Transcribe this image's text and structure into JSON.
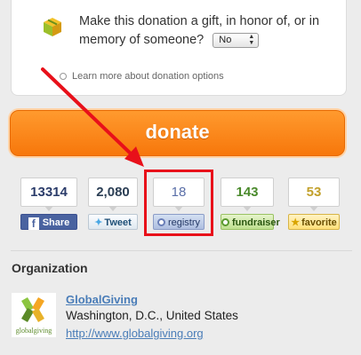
{
  "gift": {
    "text": "Make this donation a gift, in honor of, or in memory of someone?",
    "select_value": "No",
    "learn_more": "Learn more about donation options"
  },
  "donate": {
    "label": "donate"
  },
  "stats": [
    {
      "key": "facebook",
      "count": "13314",
      "label": "Share"
    },
    {
      "key": "twitter",
      "count": "2,080",
      "label": "Tweet"
    },
    {
      "key": "registry",
      "count": "18",
      "label": "registry"
    },
    {
      "key": "fundraiser",
      "count": "143",
      "label": "fundraiser"
    },
    {
      "key": "favorite",
      "count": "53",
      "label": "favorite"
    }
  ],
  "organization": {
    "heading": "Organization",
    "logo_text": "globalgiving",
    "name": "GlobalGiving",
    "location": "Washington, D.C., United States",
    "url": "http://www.globalgiving.org"
  },
  "colors": {
    "donate_orange": "#f7770b",
    "highlight_red": "#e8101a",
    "link_blue": "#4a7db8"
  }
}
